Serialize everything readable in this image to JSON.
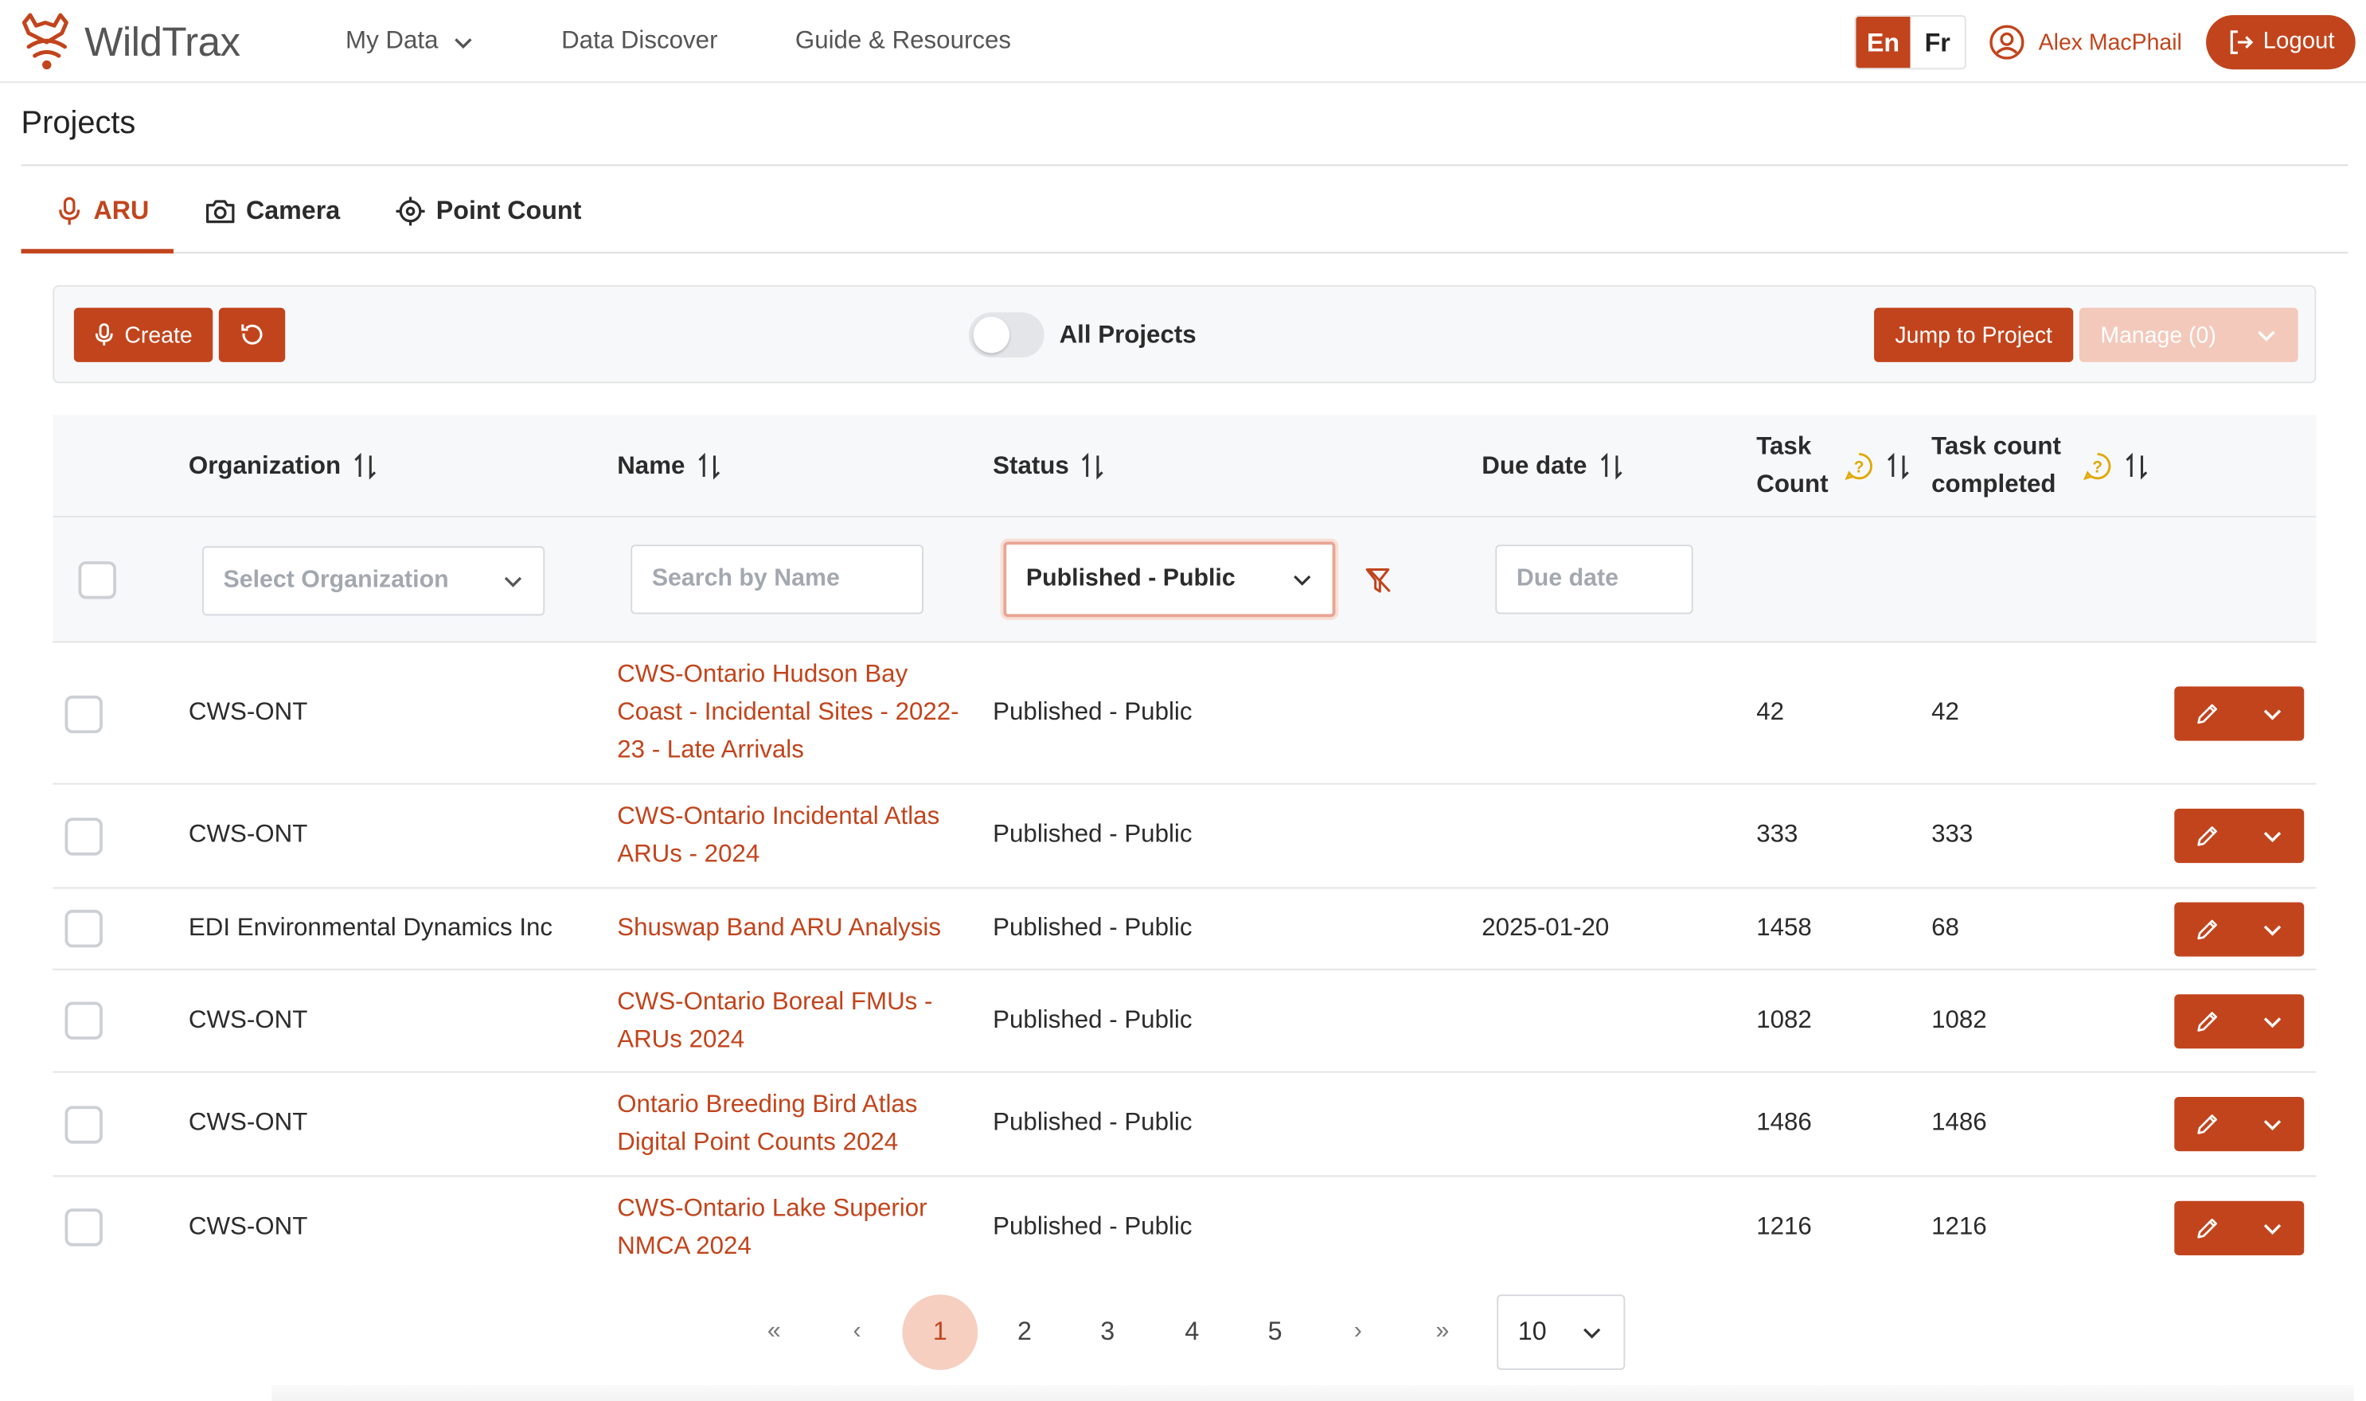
{
  "brand": {
    "name": "WildTrax"
  },
  "nav": {
    "my_data": "My Data",
    "data_discover": "Data Discover",
    "guide": "Guide & Resources"
  },
  "lang": {
    "en": "En",
    "fr": "Fr"
  },
  "user": {
    "name": "Alex MacPhail",
    "logout": "Logout"
  },
  "page": {
    "title": "Projects"
  },
  "tabs": [
    {
      "label": "ARU",
      "icon": "microphone-icon"
    },
    {
      "label": "Camera",
      "icon": "camera-icon"
    },
    {
      "label": "Point Count",
      "icon": "target-icon"
    }
  ],
  "toolbar": {
    "create": "Create",
    "all_projects": "All Projects",
    "jump": "Jump to Project",
    "manage": "Manage (0)"
  },
  "table": {
    "columns": {
      "organization": "Organization",
      "name": "Name",
      "status": "Status",
      "due_date": "Due date",
      "task_count_1": "Task",
      "task_count_2": "Count",
      "task_completed_1": "Task count",
      "task_completed_2": "completed"
    },
    "filters": {
      "organization_placeholder": "Select Organization",
      "name_placeholder": "Search by Name",
      "status_value": "Published - Public",
      "due_placeholder": "Due date"
    },
    "rows": [
      {
        "org": "CWS-ONT",
        "name": "CWS-Ontario Hudson Bay Coast - Incidental Sites - 2022-23 - Late Arrivals",
        "status": "Published - Public",
        "due": "",
        "tasks": "42",
        "completed": "42"
      },
      {
        "org": "CWS-ONT",
        "name": "CWS-Ontario Incidental Atlas ARUs - 2024",
        "status": "Published - Public",
        "due": "",
        "tasks": "333",
        "completed": "333"
      },
      {
        "org": "EDI Environmental Dynamics Inc",
        "name": "Shuswap Band ARU Analysis",
        "status": "Published - Public",
        "due": "2025-01-20",
        "tasks": "1458",
        "completed": "68"
      },
      {
        "org": "CWS-ONT",
        "name": "CWS-Ontario Boreal FMUs - ARUs 2024",
        "status": "Published - Public",
        "due": "",
        "tasks": "1082",
        "completed": "1082"
      },
      {
        "org": "CWS-ONT",
        "name": "Ontario Breeding Bird Atlas Digital Point Counts 2024",
        "status": "Published - Public",
        "due": "",
        "tasks": "1486",
        "completed": "1486"
      },
      {
        "org": "CWS-ONT",
        "name": "CWS-Ontario Lake Superior NMCA 2024",
        "status": "Published - Public",
        "due": "",
        "tasks": "1216",
        "completed": "1216"
      }
    ]
  },
  "pagination": {
    "first": "«",
    "prev": "‹",
    "pages": [
      "1",
      "2",
      "3",
      "4",
      "5"
    ],
    "current": "1",
    "next": "›",
    "last": "»",
    "per_page": "10"
  },
  "colors": {
    "accent": "#c2441c",
    "accent_light": "#f6cfc1",
    "header_bg": "#f7f8fa"
  }
}
